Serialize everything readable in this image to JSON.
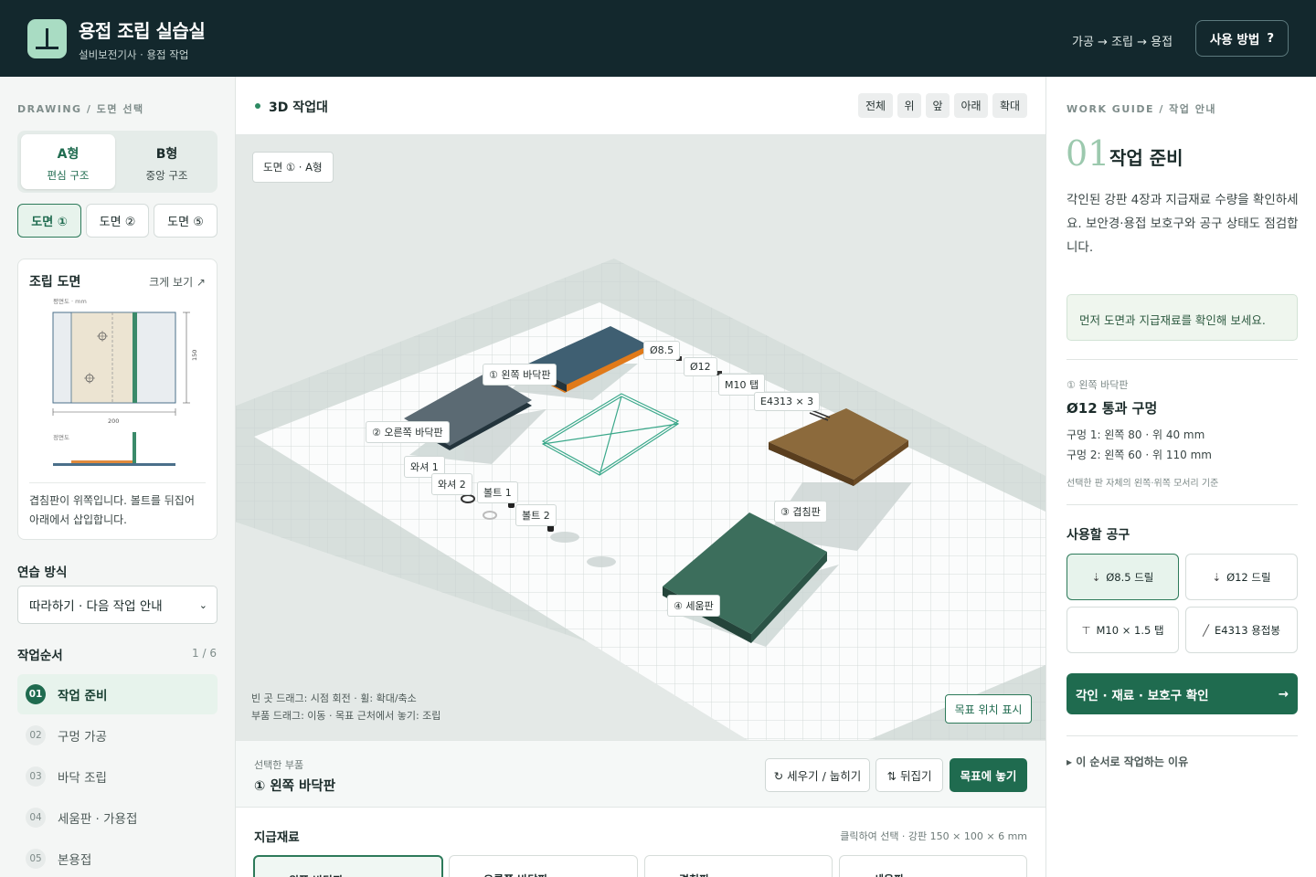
{
  "header": {
    "title": "용접 조립 실습실",
    "subtitle": "설비보전기사 · 용접 작업",
    "flow": "가공 → 조립 → 용접",
    "help_label": "사용 방법",
    "help_icon": "?"
  },
  "left": {
    "section_label": "DRAWING / 도면 선택",
    "types": [
      {
        "name": "A형",
        "desc": "편심 구조"
      },
      {
        "name": "B형",
        "desc": "중앙 구조"
      }
    ],
    "drawings": [
      "도면 ①",
      "도면 ②",
      "도면 ⑤"
    ],
    "drawing_card": {
      "title": "조립 도면",
      "enlarge": "크게 보기 ↗",
      "plan_label": "평면도 · mm",
      "side_label": "정면도",
      "dim_w": "200",
      "dim_h": "150",
      "note": "겹침판이 위쪽입니다. 볼트를 뒤집어 아래에서 삽입합니다."
    },
    "practice_label": "연습 방식",
    "practice_value": "따라하기 · 다음 작업 안내",
    "order_label": "작업순서",
    "order_count": "1 / 6",
    "steps": [
      {
        "num": "01",
        "label": "작업 준비"
      },
      {
        "num": "02",
        "label": "구멍 가공"
      },
      {
        "num": "03",
        "label": "바닥 조립"
      },
      {
        "num": "04",
        "label": "세움판 · 가용접"
      },
      {
        "num": "05",
        "label": "본용접"
      }
    ]
  },
  "center": {
    "workbench_title": "3D 작업대",
    "views": [
      "전체",
      "위",
      "앞",
      "아래",
      "확대"
    ],
    "scene_tag": "도면 ① · A형",
    "labels": {
      "left_plate": "① 왼쪽 바닥판",
      "right_plate": "② 오른쪽 바닥판",
      "overlap": "③ 겹침판",
      "upright": "④ 세움판",
      "d85": "Ø8.5",
      "d12": "Ø12",
      "tap": "M10 탭",
      "rod": "E4313 × 3",
      "washer1": "와셔 1",
      "washer2": "와셔 2",
      "bolt1": "볼트 1",
      "bolt2": "볼트 2"
    },
    "hint1": "빈 곳 드래그: 시점 회전 · 휠: 확대/축소",
    "hint2": "부품 드래그: 이동 · 목표 근처에서 놓기: 조립",
    "target_btn": "목표 위치 표시",
    "selected_caption": "선택한 부품",
    "selected_name": "① 왼쪽 바닥판",
    "actions": {
      "rotate": "↻ 세우기 / 눕히기",
      "flip": "⇅ 뒤집기",
      "place": "목표에 놓기"
    },
    "materials_title": "지급재료",
    "materials_note": "클릭하여 선택 · 강판 150 × 100 × 6 mm",
    "materials": [
      "왼쪽 바닥판",
      "오른쪽 바닥판",
      "겹침판",
      "세움판"
    ]
  },
  "right": {
    "section_label": "WORK GUIDE / 작업 안내",
    "step_num": "01",
    "step_title": "작업 준비",
    "desc": "각인된 강판 4장과 지급재료 수량을 확인하세요. 보안경·용접 보호구와 공구 상태도 점검합니다.",
    "tip": "먼저 도면과 지급재료를 확인해 보세요.",
    "part_caption": "① 왼쪽 바닥판",
    "hole_title": "Ø12 통과 구멍",
    "hole1": "구멍 1: 왼쪽 80 · 위 40 mm",
    "hole2": "구멍 2: 왼쪽 60 · 위 110 mm",
    "hole_note": "선택한 판 자체의 왼쪽·위쪽 모서리 기준",
    "tools_title": "사용할 공구",
    "tools": [
      "Ø8.5 드릴",
      "Ø12 드릴",
      "M10 × 1.5 탭",
      "E4313 용접봉"
    ],
    "confirm_btn": "각인 · 재료 · 보호구 확인",
    "confirm_arrow": "→",
    "why": "▸ 이 순서로 작업하는 이유"
  },
  "colors": {
    "header_bg": "#13282d",
    "accent": "#1f6b4f",
    "plate_blue": "#3f5f72",
    "plate_gray": "#5b6a73",
    "plate_brown": "#8c6a3c",
    "plate_green": "#3c6e5c"
  }
}
